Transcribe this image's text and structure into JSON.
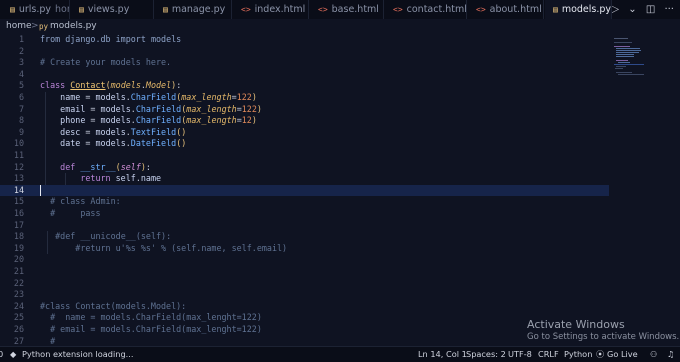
{
  "tabs": [
    {
      "icon": "python-file-icon",
      "label": "urls.py",
      "desc": "home",
      "active": false
    },
    {
      "icon": "python-file-icon",
      "label": "views.py",
      "desc": "",
      "active": false
    },
    {
      "icon": "python-file-icon",
      "label": "manage.py",
      "desc": "",
      "active": false
    },
    {
      "icon": "html-file-icon",
      "label": "index.html",
      "desc": "",
      "active": false
    },
    {
      "icon": "html-file-icon",
      "label": "base.html",
      "desc": "",
      "active": false
    },
    {
      "icon": "html-file-icon",
      "label": "contact.html",
      "desc": "",
      "active": false
    },
    {
      "icon": "html-file-icon",
      "label": "about.html",
      "desc": "",
      "active": false
    },
    {
      "icon": "python-file-icon",
      "label": "models.py",
      "desc": "",
      "active": true,
      "close": "×"
    }
  ],
  "actions": {
    "run": "▷",
    "dropdown": "⌄",
    "split": "◫",
    "more": "···"
  },
  "breadcrumb": {
    "folder": "home",
    "separator": ">",
    "file": "models.py"
  },
  "editor": {
    "current_line": 14,
    "lines": [
      {
        "n": "1",
        "segs": [
          [
            "imp",
            "from "
          ],
          [
            "imp",
            "django.db "
          ],
          [
            "imp",
            "import "
          ],
          [
            "imp",
            "models"
          ]
        ]
      },
      {
        "n": "2",
        "segs": []
      },
      {
        "n": "3",
        "segs": [
          [
            "comment",
            "# Create your models here."
          ]
        ]
      },
      {
        "n": "4",
        "segs": []
      },
      {
        "n": "5",
        "segs": [
          [
            "kw",
            "class "
          ],
          [
            "cls",
            "Contact"
          ],
          [
            "br",
            "("
          ],
          [
            "param",
            "models"
          ],
          [
            "op",
            "."
          ],
          [
            "param",
            "Model"
          ],
          [
            "br",
            ")"
          ],
          [
            "op",
            ":"
          ]
        ]
      },
      {
        "n": "6",
        "segs": [
          [
            "plain",
            "    "
          ],
          [
            "var",
            "name"
          ],
          [
            "op",
            " = "
          ],
          [
            "var",
            "models"
          ],
          [
            "op",
            "."
          ],
          [
            "fn",
            "CharField"
          ],
          [
            "br",
            "("
          ],
          [
            "param",
            "max_length"
          ],
          [
            "op",
            "="
          ],
          [
            "num",
            "122"
          ],
          [
            "br",
            ")"
          ]
        ]
      },
      {
        "n": "7",
        "segs": [
          [
            "plain",
            "    "
          ],
          [
            "var",
            "email"
          ],
          [
            "op",
            " = "
          ],
          [
            "var",
            "models"
          ],
          [
            "op",
            "."
          ],
          [
            "fn",
            "CharField"
          ],
          [
            "br",
            "("
          ],
          [
            "param",
            "max_length"
          ],
          [
            "op",
            "="
          ],
          [
            "num",
            "122"
          ],
          [
            "br",
            ")"
          ]
        ]
      },
      {
        "n": "8",
        "segs": [
          [
            "plain",
            "    "
          ],
          [
            "var",
            "phone"
          ],
          [
            "op",
            " = "
          ],
          [
            "var",
            "models"
          ],
          [
            "op",
            "."
          ],
          [
            "fn",
            "CharField"
          ],
          [
            "br",
            "("
          ],
          [
            "param",
            "max_length"
          ],
          [
            "op",
            "="
          ],
          [
            "num",
            "12"
          ],
          [
            "br",
            ")"
          ]
        ]
      },
      {
        "n": "9",
        "segs": [
          [
            "plain",
            "    "
          ],
          [
            "var",
            "desc"
          ],
          [
            "op",
            " = "
          ],
          [
            "var",
            "models"
          ],
          [
            "op",
            "."
          ],
          [
            "fn",
            "TextField"
          ],
          [
            "br",
            "()"
          ]
        ]
      },
      {
        "n": "10",
        "segs": [
          [
            "plain",
            "    "
          ],
          [
            "var",
            "date"
          ],
          [
            "op",
            " = "
          ],
          [
            "var",
            "models"
          ],
          [
            "op",
            "."
          ],
          [
            "fn",
            "DateField"
          ],
          [
            "br",
            "()"
          ]
        ]
      },
      {
        "n": "11",
        "segs": []
      },
      {
        "n": "12",
        "segs": [
          [
            "plain",
            "    "
          ],
          [
            "kw",
            "def "
          ],
          [
            "fn",
            "__str__"
          ],
          [
            "br",
            "("
          ],
          [
            "self",
            "self"
          ],
          [
            "br",
            ")"
          ],
          [
            "op",
            ":"
          ]
        ]
      },
      {
        "n": "13",
        "segs": [
          [
            "plain",
            "        "
          ],
          [
            "kw",
            "return "
          ],
          [
            "var",
            "self"
          ],
          [
            "op",
            "."
          ],
          [
            "var",
            "name"
          ]
        ]
      },
      {
        "n": "14",
        "segs": []
      },
      {
        "n": "15",
        "segs": [
          [
            "plain",
            "  "
          ],
          [
            "comment",
            "# class Admin:"
          ]
        ]
      },
      {
        "n": "16",
        "segs": [
          [
            "comment",
            "  #     pass"
          ]
        ]
      },
      {
        "n": "17",
        "segs": []
      },
      {
        "n": "18",
        "segs": [
          [
            "plain",
            "   "
          ],
          [
            "comment",
            "#def __unicode__(self):"
          ]
        ]
      },
      {
        "n": "19",
        "segs": [
          [
            "plain",
            "       "
          ],
          [
            "comment",
            "#return u'%s %s' % (self.name, self.email)"
          ]
        ]
      },
      {
        "n": "20",
        "segs": []
      },
      {
        "n": "21",
        "segs": []
      },
      {
        "n": "22",
        "segs": []
      },
      {
        "n": "23",
        "segs": []
      },
      {
        "n": "24",
        "segs": [
          [
            "comment",
            "#class Contact(models.Model):"
          ]
        ]
      },
      {
        "n": "25",
        "segs": [
          [
            "comment",
            "  #  name = models.CharField(max_lenght=122)"
          ]
        ]
      },
      {
        "n": "26",
        "segs": [
          [
            "comment",
            "  # email = models.CharField(max_lenght=122)"
          ]
        ]
      },
      {
        "n": "27",
        "segs": [
          [
            "comment",
            "  #"
          ]
        ]
      }
    ]
  },
  "watermark": {
    "title": "Activate Windows",
    "subtitle": "Go to Settings to activate Windows."
  },
  "status": {
    "errors": "0",
    "loading": "Python extension loading...",
    "position": "Ln 14, Col 1",
    "spaces": "Spaces: 2",
    "encoding": "UTF-8",
    "eol": "CRLF",
    "language": "Python",
    "golive": "Go Live"
  }
}
